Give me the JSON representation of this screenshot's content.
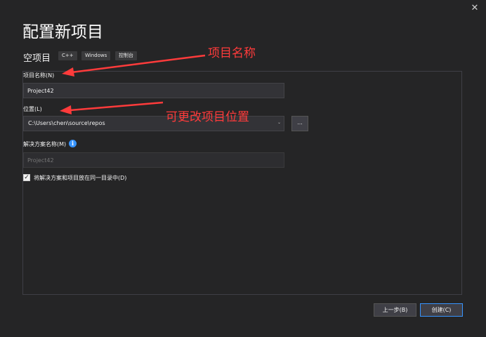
{
  "window": {
    "close_glyph": "✕"
  },
  "header": {
    "title": "配置新项目",
    "template_name": "空项目",
    "tags": [
      "C++",
      "Windows",
      "控制台"
    ]
  },
  "form": {
    "project_name_label": "项目名称(N)",
    "project_name_value": "Project42",
    "location_label": "位置(L)",
    "location_value": "C:\\Users\\chen\\source\\repos",
    "location_chevron": "⌄",
    "browse_label": "...",
    "solution_name_label": "解决方案名称(M)",
    "solution_name_placeholder": "Project42",
    "info_glyph": "i",
    "same_dir_checkbox": {
      "checked": true,
      "check_glyph": "✓",
      "label": "将解决方案和项目放在同一目录中(D)"
    }
  },
  "footer": {
    "back_label": "上一步(B)",
    "create_label": "创建(C)"
  },
  "annotations": {
    "project_name_note": "项目名称",
    "location_note": "可更改项目位置",
    "color": "#ff3b3b"
  },
  "colors": {
    "background": "#252526",
    "accent": "#3794ff"
  }
}
